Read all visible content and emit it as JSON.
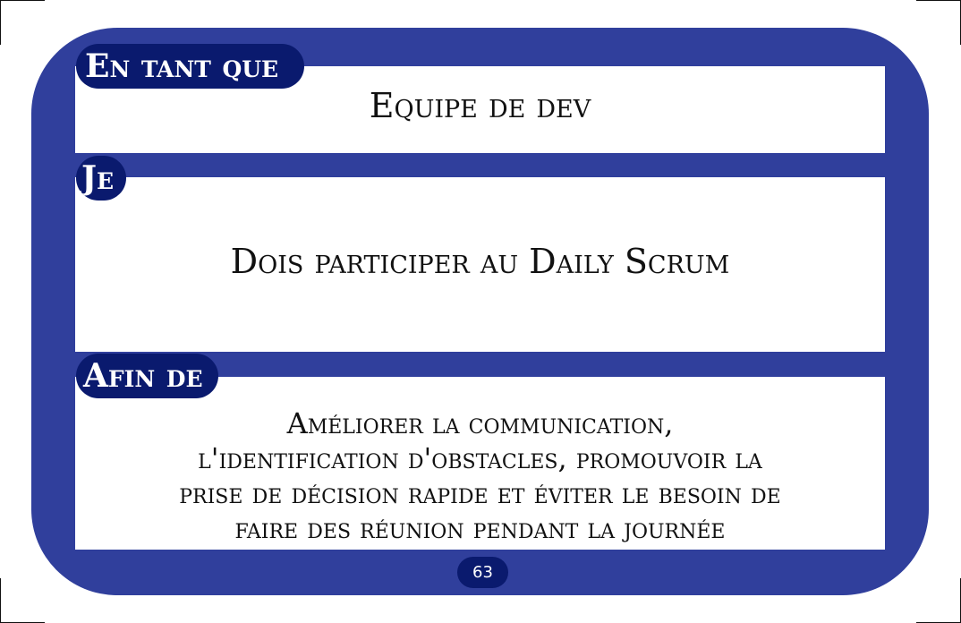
{
  "card": {
    "section_1": {
      "label": "En tant que",
      "value": "Equipe de dev"
    },
    "section_2": {
      "label": "Je",
      "value": "Dois participer au Daily Scrum"
    },
    "section_3": {
      "label": "Afin de",
      "lines": [
        "Améliorer la communication,",
        "l'identification d'obstacles, promouvoir la",
        "prise de décision rapide et éviter le besoin de",
        "faire des réunion pendant la journée"
      ]
    },
    "page_number": "63"
  },
  "colors": {
    "frame": "#303f9c",
    "pill": "#0a1a6e",
    "panel": "#ffffff",
    "text": "#111111"
  }
}
